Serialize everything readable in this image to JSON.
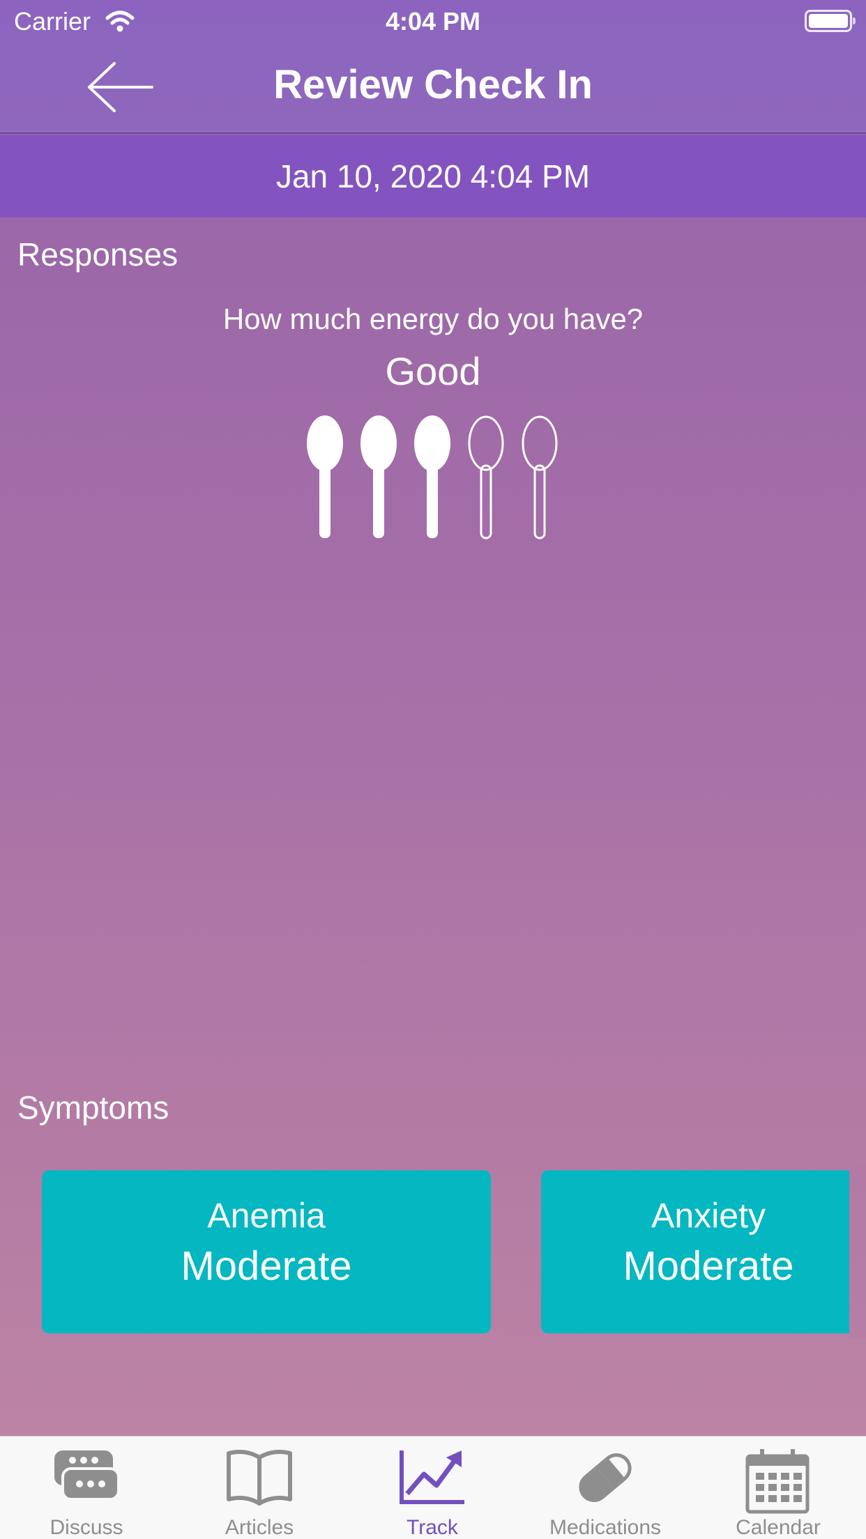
{
  "status_bar": {
    "carrier": "Carrier",
    "time": "4:04 PM"
  },
  "nav": {
    "title": "Review Check In"
  },
  "date": "Jan 10, 2020 4:04 PM",
  "responses": {
    "heading": "Responses",
    "question": "How much energy do you have?",
    "answer": "Good",
    "spoons_filled": 3,
    "spoons_total": 5
  },
  "symptoms": {
    "heading": "Symptoms",
    "items": [
      {
        "name": "Anemia",
        "level": "Moderate"
      },
      {
        "name": "Anxiety",
        "level": "Moderate"
      }
    ]
  },
  "tabs": [
    {
      "label": "Discuss",
      "icon": "chat-bubbles-icon",
      "active": false
    },
    {
      "label": "Articles",
      "icon": "open-book-icon",
      "active": false
    },
    {
      "label": "Track",
      "icon": "trend-chart-icon",
      "active": true
    },
    {
      "label": "Medications",
      "icon": "pill-icon",
      "active": false
    },
    {
      "label": "Calendar",
      "icon": "calendar-icon",
      "active": false
    }
  ],
  "colors": {
    "accent": "#7450bd",
    "symptom_card": "#04b7c1",
    "date_band": "#8353c0",
    "inactive_tab": "#8e8e8e"
  }
}
